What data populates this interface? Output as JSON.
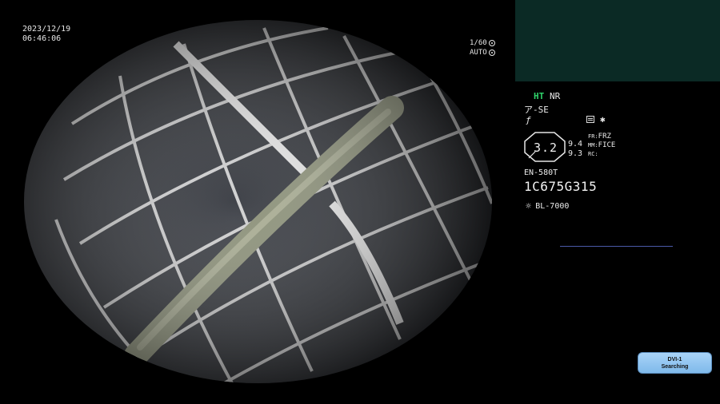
{
  "overlay": {
    "date": "2023/12/19",
    "time": "06:46:06",
    "shutter": "1/60",
    "exposure_mode": "AUTO"
  },
  "panel": {
    "ht": "HT",
    "nr": "NR",
    "se": "ア-SE",
    "f_symbol": "ƒ",
    "star": "✱",
    "zoom": "3.2",
    "enhance_top": "9.4",
    "enhance_bottom": "9.3",
    "fr": "FR:",
    "frz": "FRZ",
    "mm": "MM:",
    "fice": "FICE",
    "rc": "RC:",
    "scope_model": "EN-580T",
    "serial": "1C675G315",
    "light_source": "BL-7000"
  },
  "status": {
    "line1": "DVI-1",
    "line2": "Searching"
  },
  "colors": {
    "ht": "#2fd36a",
    "thumbnail": "#0b2a25",
    "status_button": "#8fc4f0"
  },
  "icons": {
    "shutter": "iris-icon",
    "auto": "iris-icon",
    "memo": "memo-icon",
    "light": "sun-icon"
  }
}
